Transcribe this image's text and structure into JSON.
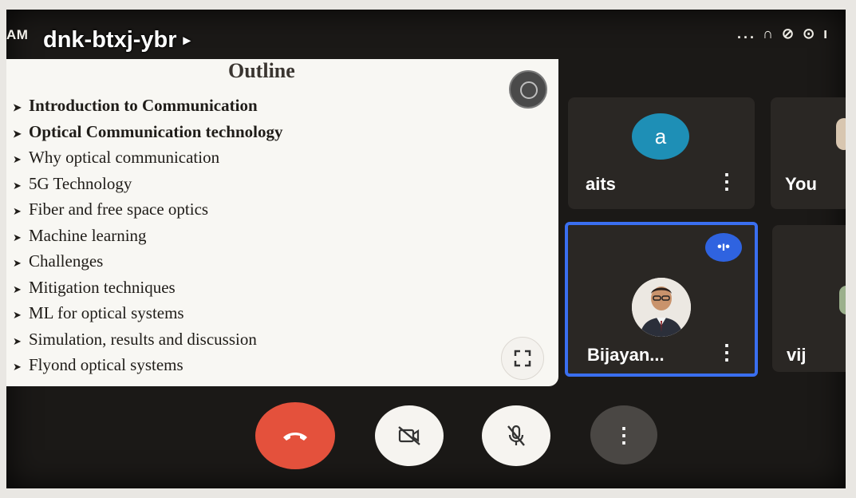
{
  "status_bar": {
    "time": "AM",
    "icons": "... ∩ ⊘ ⊙ ı"
  },
  "meeting": {
    "code": "dnk-btxj-ybr",
    "caret": "▸"
  },
  "slide": {
    "title": "Outline",
    "items": [
      {
        "text": "Introduction to Communication",
        "bold": true
      },
      {
        "text": "Optical Communication technology",
        "bold": true
      },
      {
        "text": "Why optical communication",
        "bold": false
      },
      {
        "text": "5G Technology",
        "bold": false
      },
      {
        "text": "Fiber and free space optics",
        "bold": false
      },
      {
        "text": "Machine learning",
        "bold": false
      },
      {
        "text": "Challenges",
        "bold": false
      },
      {
        "text": "Mitigation techniques",
        "bold": false
      },
      {
        "text": "ML for optical systems",
        "bold": false
      },
      {
        "text": "Simulation, results and discussion",
        "bold": false
      },
      {
        "text": "Flyond optical systems",
        "bold": false
      }
    ],
    "bullet": "➤"
  },
  "participants": {
    "aits": {
      "name": "aits",
      "avatar_letter": "a"
    },
    "you": {
      "name": "You"
    },
    "bijayan": {
      "name": "Bijayan..."
    },
    "vija": {
      "name": "vij"
    }
  },
  "icons": {
    "menu": "⋮",
    "speaking": "•ı•",
    "fullscreen": "⛶"
  },
  "controls": {
    "end_call": "end-call",
    "camera_off": "camera-off",
    "mic_off": "mic-off",
    "more": "⋮"
  },
  "colors": {
    "accent": "#3a6ff0",
    "end_call": "#e4513c",
    "avatar": "#1e8fb6"
  }
}
